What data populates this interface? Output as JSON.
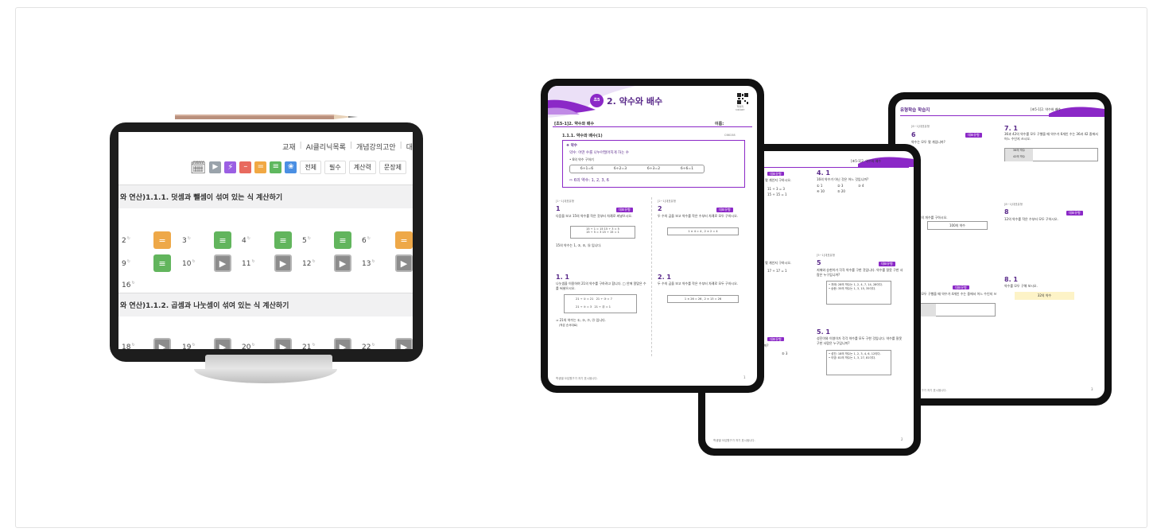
{
  "tablet_left": {
    "nav": [
      "교재",
      "AI클리닉목록",
      "개념강의고안",
      "대"
    ],
    "toolbar_buttons": [
      "전체",
      "필수",
      "계산력",
      "문장제"
    ],
    "toolbar_colors": [
      "#9aa3ab",
      "#9b5fe3",
      "#e86a5f",
      "#f1a843",
      "#5fb85f",
      "#4a8fe3"
    ],
    "section1": "와 연산)1.1.1. 덧셈과 뺄셈이 섞여 있는 식 계산하기",
    "section2": "와 연산)1.1.2. 곱셈과 나눗셈이 섞여 있는 식 계산하기",
    "row1": [
      {
        "num": "2",
        "icon": "orange"
      },
      {
        "num": "3",
        "icon": "green"
      },
      {
        "num": "4",
        "icon": "green"
      },
      {
        "num": "5",
        "icon": "green"
      },
      {
        "num": "6",
        "icon": "orange"
      }
    ],
    "row2": [
      {
        "num": "9",
        "icon": "green"
      },
      {
        "num": "10",
        "icon": "play"
      },
      {
        "num": "11",
        "icon": "play"
      },
      {
        "num": "12",
        "icon": "play"
      },
      {
        "num": "13",
        "icon": "play"
      }
    ],
    "row3": [
      {
        "num": "16"
      }
    ],
    "row4": [
      {
        "num": "18",
        "icon": "play"
      },
      {
        "num": "19",
        "icon": "play"
      },
      {
        "num": "20",
        "icon": "play"
      },
      {
        "num": "21",
        "icon": "play"
      },
      {
        "num": "22",
        "icon": "play"
      }
    ]
  },
  "page_front": {
    "badge": "초5",
    "title": "2. 약수와 배수",
    "qr_caption": "학습지\n141047",
    "header_left": "[초5-1]2. 약수와 배수",
    "header_right": "이름:",
    "subtitle": "1.1.1. 약수와 배수(1)",
    "subtitle_code": "C66158",
    "concept_label": "약수",
    "concept_def": "약수: 어떤 수를 나누어떨어지게 하는 수",
    "concept_example_title": "• 6의 약수 구하기",
    "concept_eqs": [
      "6÷1=6",
      "6÷2=3",
      "6÷3=2",
      "6÷6=1"
    ],
    "concept_result": "⇨ 6의 약수: 1, 2, 3, 6",
    "q1_label": "[1~1]대표유형",
    "q1_num": "1",
    "q1_text": "다음을 보고 15의 약수를 작은 것부터 차례로 써넣으시오.",
    "q1_box": "15 ÷ 1 = 15    15 ÷ 3 = 5\n15 ÷ 5 = 3    15 ÷ 15 = 1",
    "q1_answer": "15의 약수는 1, ③, ⑤, ⑮ 입니다.",
    "q2_label": "[2~1]대표유형",
    "q2_num": "2",
    "q2_text": "두 수의 곱을 보고 약수를 작은 수부터 차례로 모두 구하시오.",
    "q2_box": "1 × 4 = 4 ,  2 × 2 = 4",
    "q3_num": "1. 1",
    "q3_text": "나눗셈을 이용하여 21의 약수를 구하려고 합니다. □ 안에 알맞은 수를 써넣으시오.",
    "q3_answer": "⇒ 21의 약수는 ①, ③, ⑦, ㉑ 입니다.",
    "q3_note": "(작은 순서대로)",
    "q4_num": "2. 1",
    "q4_text": "두 수의 곱을 보고 약수를 작은 수부터 차례로 모두 구하시오.",
    "q4_box": "1 × 26 = 26 ,  2 × 13 = 26",
    "footer": "학생별 오답원구가 저기 표시됩니다.",
    "page_num": "1"
  },
  "page_middle": {
    "header": "[초5-1]2. 약수와 배수",
    "q4_num": "4. 1",
    "q4_text": "16의 약수가 아닌 것은 어느 것입니까?",
    "q4_options": [
      "① 1",
      "② 3",
      "③ 4",
      "④ 10",
      "⑤ 20"
    ],
    "q5_label": "[5~1]대표유형",
    "q5_num": "5",
    "q5_text": "지애와 승현이가 각각 약수를 구한 것입니다. 약수를 잘못 구한 사람은 누구입니까?",
    "q5_box": "• 지애: 28의 약수는 1, 2, 4, 7, 14, 28이다.\n• 승현: 35의 약수는 1, 3, 15, 35이다.",
    "q6_num": "5. 1",
    "q6_text": "성진이와 이영이가 각각 약수를 모두 구한 것입니다. 약수를 잘못 구한 사람은 누구입니까?",
    "q6_box": "• 성진: 18의 약수는 1, 2, 3, 4, 6, 12이다.\n• 이영: 81의 약수는 1, 3, 27, 81이다.",
    "footer": "학생별 오답원구가 저기 표시됩니다.",
    "page_num": "2"
  },
  "page_back": {
    "header_left": "유형학습 학습지",
    "header_right": "[초5-1]2. 약수와 배수",
    "q6_label": "[6~1]대표유형",
    "q6_num": "6",
    "q6_text": "약수는 모두 몇 개입니까?",
    "q7_num": "7. 1",
    "q7_text": "36과 42의 약수를 모두 구했을 때 약수가 6개인 수는 36과 42 중에서 어느 수인지 쓰시오.",
    "q7_rows": [
      "36의 약수",
      "42의 약수"
    ],
    "q8_label": "[8~1]대표유형",
    "q8_num": "8",
    "q8_text": "12의 약수를 작은 수부터 모두 구하시오.",
    "q_mid_text": "의 약수의 개수를 구하시오.",
    "q_mid_box": "100의 약수",
    "q9_num": "8. 1",
    "q9_text": "약수를 모두 구해 보시오.",
    "q9_box": "32의 약수",
    "q10_rows": [
      "의 약수",
      "의 약수"
    ],
    "q10_text": "약수를 모두 구했을 때 약수가 4개인 수는 중에서 어느 수인지 쓰시오.",
    "footer": "답원구가 저기 표시됩니다.",
    "page_num": "3"
  }
}
